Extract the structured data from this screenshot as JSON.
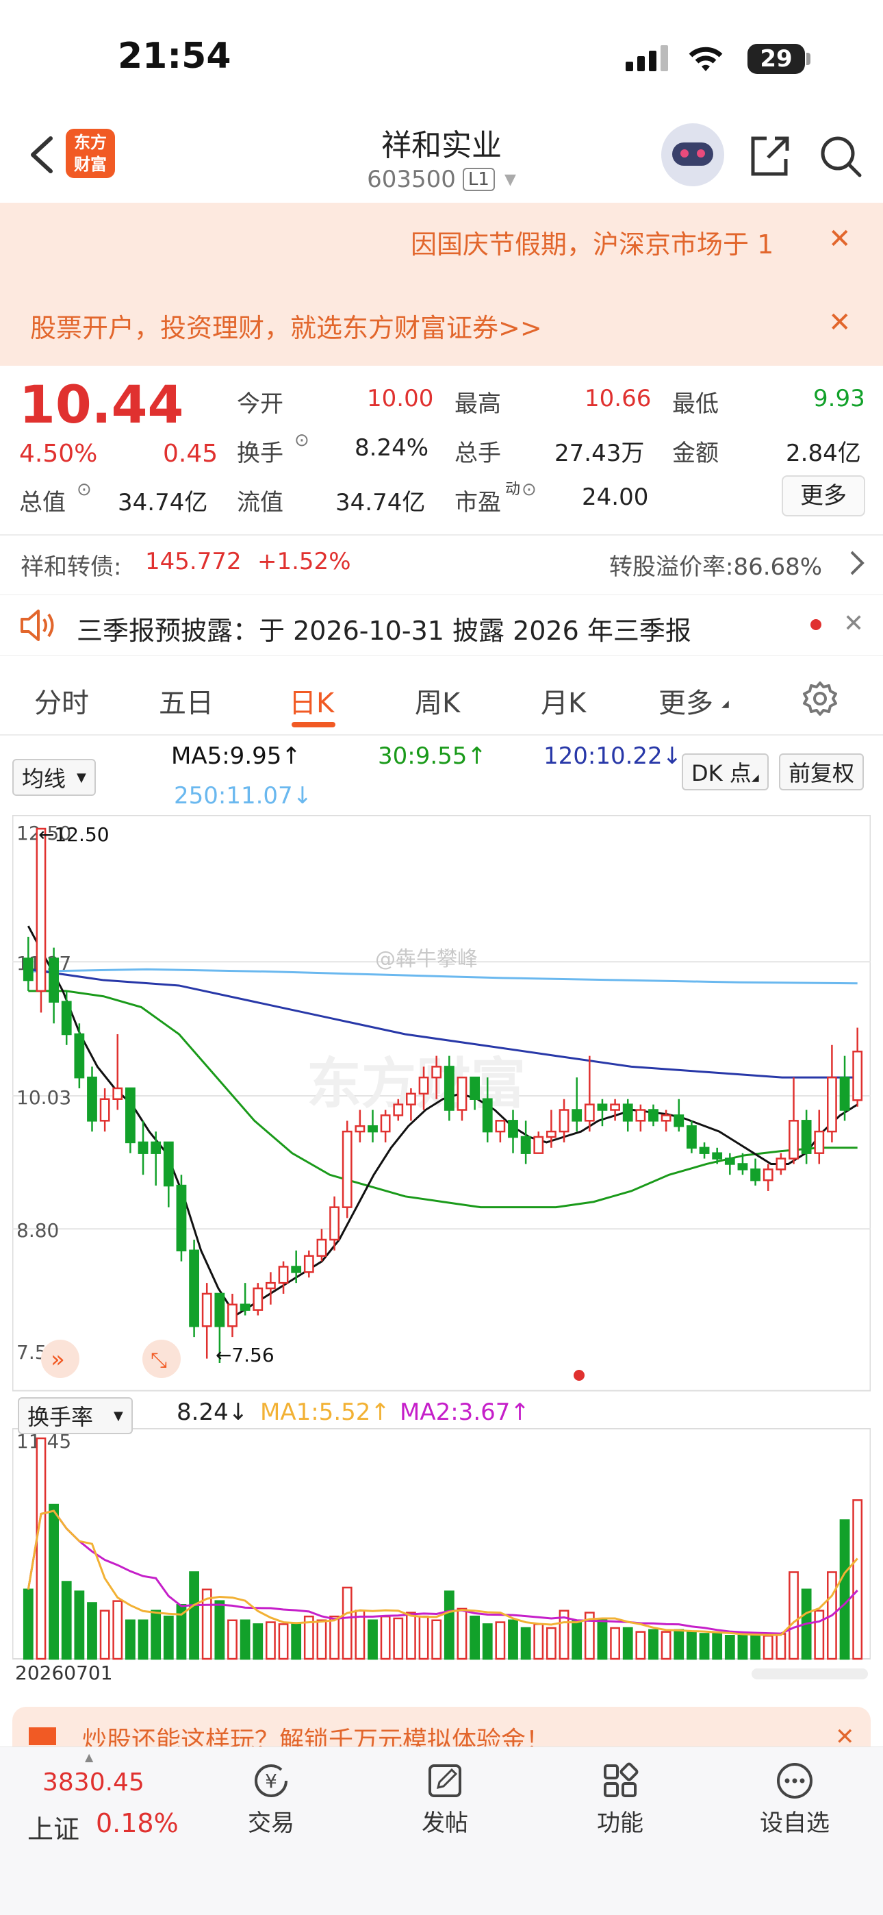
{
  "status": {
    "time": "21:54",
    "battery": "29"
  },
  "header": {
    "logo": "东方\n财富",
    "title": "祥和实业",
    "code": "603500",
    "level": "L1"
  },
  "banners": [
    {
      "text": "因国庆节假期，沪深京市场于 1"
    },
    {
      "text": "股票开户，投资理财，就选东方财富证券>>"
    }
  ],
  "quote": {
    "price": "10.44",
    "change_pct": "4.50%",
    "change": "0.45",
    "open_label": "今开",
    "open": "10.00",
    "high_label": "最高",
    "high": "10.66",
    "low_label": "最低",
    "low": "9.93",
    "turnover_label": "换手",
    "turnover": "8.24%",
    "volume_label": "总手",
    "volume": "27.43万",
    "amount_label": "金额",
    "amount": "2.84亿",
    "mktcap_label": "总值",
    "mktcap": "34.74亿",
    "float_label": "流值",
    "float": "34.74亿",
    "pe_label": "市盈",
    "pe_sup": "动",
    "pe": "24.00",
    "more": "更多"
  },
  "bond": {
    "name": "祥和转债:",
    "price": "145.772",
    "change": "+1.52%",
    "premium": "转股溢价率:86.68%"
  },
  "notice": {
    "text": "三季报预披露：于 2026-10-31 披露 2026 年三季报"
  },
  "tabs": [
    "分时",
    "五日",
    "日K",
    "周K",
    "月K",
    "更多"
  ],
  "ma": {
    "selector": "均线",
    "ma5": "MA5:9.95",
    "ma30": "30:9.55",
    "ma120": "120:10.22",
    "ma250": "250:11.07",
    "dk": "DK 点",
    "adjust": "前复权"
  },
  "turnover_panel": {
    "selector": "换手率",
    "value": "8.24",
    "ma1": "MA1:5.52",
    "ma2": "MA2:3.67",
    "top": "11.45",
    "date": "20260701"
  },
  "promo": {
    "text": "炒股还能这样玩？解锁千万元模拟体验金！"
  },
  "bottom_nav": {
    "index_value": "3830.45",
    "index_name": "上证",
    "index_change": "0.18%",
    "items": [
      "交易",
      "发帖",
      "功能",
      "设自选"
    ]
  },
  "colors": {
    "up": "#e0312f",
    "down": "#12a12a",
    "accent": "#f15a24",
    "ma5": "#111111",
    "ma30": "#1a9a1a",
    "ma120": "#2838a8",
    "ma250": "#6ab8ef"
  },
  "watermark": "东方财富",
  "weibo_mark": "@犇牛攀峰",
  "chart_data": {
    "type": "candlestick",
    "y_ticks": [
      "12.50",
      "11.27",
      "10.03",
      "8.80",
      "7.56"
    ],
    "ylim": [
      7.56,
      12.5
    ],
    "annotations": [
      "←12.50",
      "←7.56"
    ],
    "candles": [
      [
        11.3,
        11.5,
        11.1,
        11.0,
        0
      ],
      [
        11.0,
        11.1,
        12.5,
        10.8,
        1
      ],
      [
        11.3,
        11.4,
        10.9,
        10.7,
        0
      ],
      [
        10.9,
        11.0,
        10.6,
        10.5,
        0
      ],
      [
        10.6,
        10.7,
        10.2,
        10.1,
        0
      ],
      [
        10.2,
        10.3,
        9.8,
        9.7,
        0
      ],
      [
        9.8,
        10.1,
        10.0,
        9.7,
        1
      ],
      [
        10.0,
        10.6,
        10.1,
        9.9,
        1
      ],
      [
        10.1,
        10.1,
        9.6,
        9.5,
        0
      ],
      [
        9.6,
        9.8,
        9.5,
        9.3,
        0
      ],
      [
        9.5,
        9.7,
        9.6,
        9.2,
        0
      ],
      [
        9.6,
        9.6,
        9.2,
        9.0,
        0
      ],
      [
        9.2,
        9.3,
        8.6,
        8.5,
        0
      ],
      [
        8.6,
        8.7,
        7.9,
        7.8,
        0
      ],
      [
        7.9,
        8.3,
        8.2,
        7.6,
        1
      ],
      [
        8.2,
        8.2,
        7.9,
        7.56,
        0
      ],
      [
        7.9,
        8.2,
        8.1,
        7.8,
        1
      ],
      [
        8.1,
        8.3,
        8.05,
        8.0,
        0
      ],
      [
        8.05,
        8.3,
        8.25,
        8.0,
        1
      ],
      [
        8.25,
        8.4,
        8.3,
        8.1,
        1
      ],
      [
        8.3,
        8.5,
        8.45,
        8.2,
        1
      ],
      [
        8.45,
        8.6,
        8.4,
        8.3,
        0
      ],
      [
        8.4,
        8.6,
        8.55,
        8.35,
        1
      ],
      [
        8.55,
        8.8,
        8.7,
        8.5,
        1
      ],
      [
        8.7,
        9.1,
        9.0,
        8.6,
        1
      ],
      [
        9.0,
        9.8,
        9.7,
        8.9,
        1
      ],
      [
        9.7,
        9.9,
        9.75,
        9.6,
        1
      ],
      [
        9.75,
        9.9,
        9.7,
        9.6,
        0
      ],
      [
        9.7,
        9.9,
        9.85,
        9.6,
        1
      ],
      [
        9.85,
        10.0,
        9.95,
        9.8,
        1
      ],
      [
        9.95,
        10.1,
        10.05,
        9.8,
        1
      ],
      [
        10.05,
        10.3,
        10.2,
        9.9,
        1
      ],
      [
        10.2,
        10.4,
        10.3,
        10.0,
        1
      ],
      [
        10.3,
        10.4,
        9.9,
        9.8,
        0
      ],
      [
        9.9,
        10.2,
        10.2,
        9.8,
        1
      ],
      [
        10.2,
        10.2,
        10.0,
        9.9,
        0
      ],
      [
        10.0,
        10.2,
        9.7,
        9.6,
        0
      ],
      [
        9.7,
        9.8,
        9.8,
        9.6,
        1
      ],
      [
        9.8,
        9.9,
        9.65,
        9.5,
        0
      ],
      [
        9.65,
        9.8,
        9.5,
        9.4,
        0
      ],
      [
        9.5,
        9.7,
        9.65,
        9.5,
        1
      ],
      [
        9.65,
        9.9,
        9.7,
        9.55,
        1
      ],
      [
        9.7,
        10.0,
        9.9,
        9.6,
        1
      ],
      [
        9.9,
        10.2,
        9.8,
        9.7,
        0
      ],
      [
        9.8,
        10.4,
        9.95,
        9.7,
        1
      ],
      [
        9.95,
        10.0,
        9.9,
        9.75,
        0
      ],
      [
        9.9,
        10.0,
        9.95,
        9.8,
        1
      ],
      [
        9.95,
        10.0,
        9.8,
        9.7,
        0
      ],
      [
        9.8,
        9.95,
        9.9,
        9.7,
        1
      ],
      [
        9.9,
        9.95,
        9.8,
        9.75,
        0
      ],
      [
        9.8,
        9.9,
        9.85,
        9.7,
        1
      ],
      [
        9.85,
        10.0,
        9.75,
        9.7,
        0
      ],
      [
        9.75,
        9.8,
        9.55,
        9.5,
        0
      ],
      [
        9.55,
        9.6,
        9.5,
        9.45,
        0
      ],
      [
        9.5,
        9.55,
        9.45,
        9.4,
        0
      ],
      [
        9.45,
        9.5,
        9.4,
        9.3,
        0
      ],
      [
        9.4,
        9.5,
        9.35,
        9.3,
        0
      ],
      [
        9.35,
        9.45,
        9.25,
        9.2,
        0
      ],
      [
        9.25,
        9.4,
        9.35,
        9.15,
        1
      ],
      [
        9.35,
        9.5,
        9.45,
        9.3,
        1
      ],
      [
        9.45,
        10.2,
        9.8,
        9.4,
        1
      ],
      [
        9.8,
        9.9,
        9.5,
        9.4,
        0
      ],
      [
        9.5,
        9.9,
        9.7,
        9.4,
        1
      ],
      [
        9.7,
        10.5,
        10.2,
        9.6,
        1
      ],
      [
        10.2,
        10.4,
        9.9,
        9.8,
        0
      ],
      [
        9.99,
        10.66,
        10.44,
        9.93,
        1
      ]
    ],
    "ma5": [
      11.6,
      11.3,
      11.0,
      10.6,
      10.3,
      10.1,
      9.95,
      9.7,
      9.5,
      9.1,
      8.6,
      8.25,
      8.0,
      8.1,
      8.2,
      8.3,
      8.4,
      8.5,
      8.7,
      9.0,
      9.3,
      9.55,
      9.75,
      9.9,
      10.0,
      10.05,
      10.0,
      9.9,
      9.75,
      9.65,
      9.6,
      9.65,
      9.7,
      9.8,
      9.85,
      9.9,
      9.88,
      9.86,
      9.82,
      9.76,
      9.7,
      9.6,
      9.5,
      9.4,
      9.4,
      9.5,
      9.7,
      9.85,
      9.95
    ],
    "ma30": [
      11.0,
      11.0,
      10.95,
      10.85,
      10.6,
      10.2,
      9.8,
      9.5,
      9.3,
      9.2,
      9.1,
      9.05,
      9.0,
      9.0,
      9.0,
      9.05,
      9.15,
      9.3,
      9.4,
      9.48,
      9.52,
      9.55,
      9.55
    ],
    "ma120": [
      11.2,
      11.1,
      11.05,
      10.9,
      10.75,
      10.6,
      10.5,
      10.4,
      10.3,
      10.25,
      10.2,
      10.2
    ],
    "ma250": [
      11.18,
      11.2,
      11.18,
      11.15,
      11.12,
      11.1,
      11.08,
      11.07
    ],
    "turnover": [
      [
        3.6,
        0
      ],
      [
        11.45,
        1
      ],
      [
        8.0,
        0
      ],
      [
        4.0,
        0
      ],
      [
        3.5,
        0
      ],
      [
        2.9,
        0
      ],
      [
        2.5,
        1
      ],
      [
        3.0,
        1
      ],
      [
        2.0,
        0
      ],
      [
        2.0,
        0
      ],
      [
        2.5,
        0
      ],
      [
        2.2,
        0
      ],
      [
        2.8,
        0
      ],
      [
        4.5,
        0
      ],
      [
        3.6,
        1
      ],
      [
        3.0,
        0
      ],
      [
        2.0,
        1
      ],
      [
        2.0,
        0
      ],
      [
        1.8,
        0
      ],
      [
        1.9,
        1
      ],
      [
        1.8,
        1
      ],
      [
        1.8,
        0
      ],
      [
        2.2,
        1
      ],
      [
        2.0,
        1
      ],
      [
        2.2,
        1
      ],
      [
        3.7,
        1
      ],
      [
        2.5,
        1
      ],
      [
        2.0,
        0
      ],
      [
        2.2,
        1
      ],
      [
        2.1,
        1
      ],
      [
        2.4,
        1
      ],
      [
        2.2,
        1
      ],
      [
        2.0,
        1
      ],
      [
        3.5,
        0
      ],
      [
        2.6,
        1
      ],
      [
        2.2,
        0
      ],
      [
        1.8,
        0
      ],
      [
        1.9,
        1
      ],
      [
        2.0,
        0
      ],
      [
        1.6,
        0
      ],
      [
        1.8,
        1
      ],
      [
        1.6,
        1
      ],
      [
        2.5,
        1
      ],
      [
        2.0,
        0
      ],
      [
        2.4,
        1
      ],
      [
        2.0,
        0
      ],
      [
        1.6,
        1
      ],
      [
        1.6,
        0
      ],
      [
        1.4,
        1
      ],
      [
        1.5,
        0
      ],
      [
        1.4,
        1
      ],
      [
        1.5,
        0
      ],
      [
        1.4,
        0
      ],
      [
        1.3,
        0
      ],
      [
        1.3,
        0
      ],
      [
        1.2,
        0
      ],
      [
        1.2,
        0
      ],
      [
        1.3,
        0
      ],
      [
        1.2,
        1
      ],
      [
        1.3,
        1
      ],
      [
        4.5,
        1
      ],
      [
        3.6,
        0
      ],
      [
        2.5,
        1
      ],
      [
        4.5,
        1
      ],
      [
        7.2,
        0
      ],
      [
        8.24,
        1
      ]
    ]
  }
}
